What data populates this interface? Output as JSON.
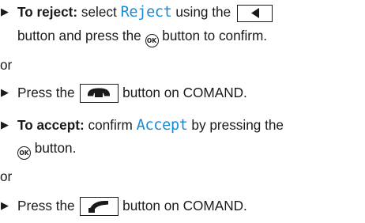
{
  "bullet_glyph": "▶",
  "items": [
    {
      "label": "To reject:",
      "text_a": "select",
      "keyword": "Reject",
      "text_b": "using the",
      "icon": "left-arrow-key-icon",
      "text_c": "button and press the",
      "ok_label": "OK",
      "text_d": "button to confirm."
    },
    {
      "text_a": "Press the",
      "icon": "hang-up-key-icon",
      "text_b": "button on COMAND."
    },
    {
      "label": "To accept:",
      "text_a": "confirm",
      "keyword": "Accept",
      "text_b": "by pressing the",
      "ok_label": "OK",
      "text_c": "button."
    },
    {
      "text_a": "Press the",
      "icon": "call-key-icon",
      "text_b": "button on COMAND."
    }
  ],
  "separators": [
    "or",
    "or"
  ],
  "colors": {
    "text": "#1a1a1a",
    "keyword": "#1a8ad4"
  }
}
